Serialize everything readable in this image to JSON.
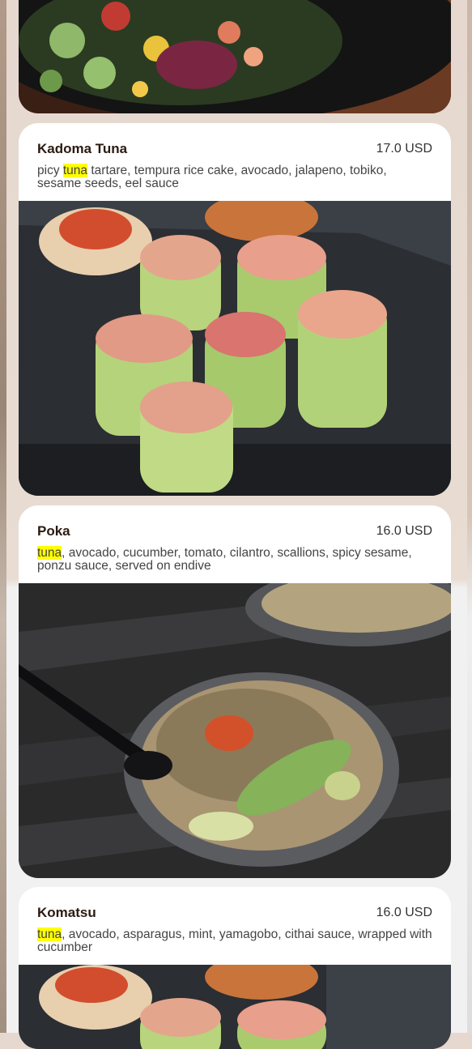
{
  "colors": {
    "highlight": "#ffff00",
    "card_bg": "#ffffff",
    "title": "#2a1a0f"
  },
  "items": [
    {
      "name": "Kadoma Tuna",
      "price": "17.0 USD",
      "desc_pre": "picy ",
      "desc_hl": "tuna",
      "desc_post": " tartare, tempura rice cake, avocado, jalapeno, tobiko, sesame seeds, eel sauce",
      "photo": "cucumber-wrapped tuna tartare rolls"
    },
    {
      "name": "Poka",
      "price": "16.0 USD",
      "desc_pre": "",
      "desc_hl": "tuna",
      "desc_post": ", avocado, cucumber, tomato, cilantro, scallions, spicy sesame, ponzu sauce, served on endive",
      "photo": "poke bowl with fork"
    },
    {
      "name": "Komatsu",
      "price": "16.0 USD",
      "desc_pre": "",
      "desc_hl": "tuna",
      "desc_post": ", avocado, asparagus, mint, yamagobo, cithai sauce, wrapped with cucumber",
      "photo": "cucumber-wrapped tuna rolls"
    }
  ]
}
